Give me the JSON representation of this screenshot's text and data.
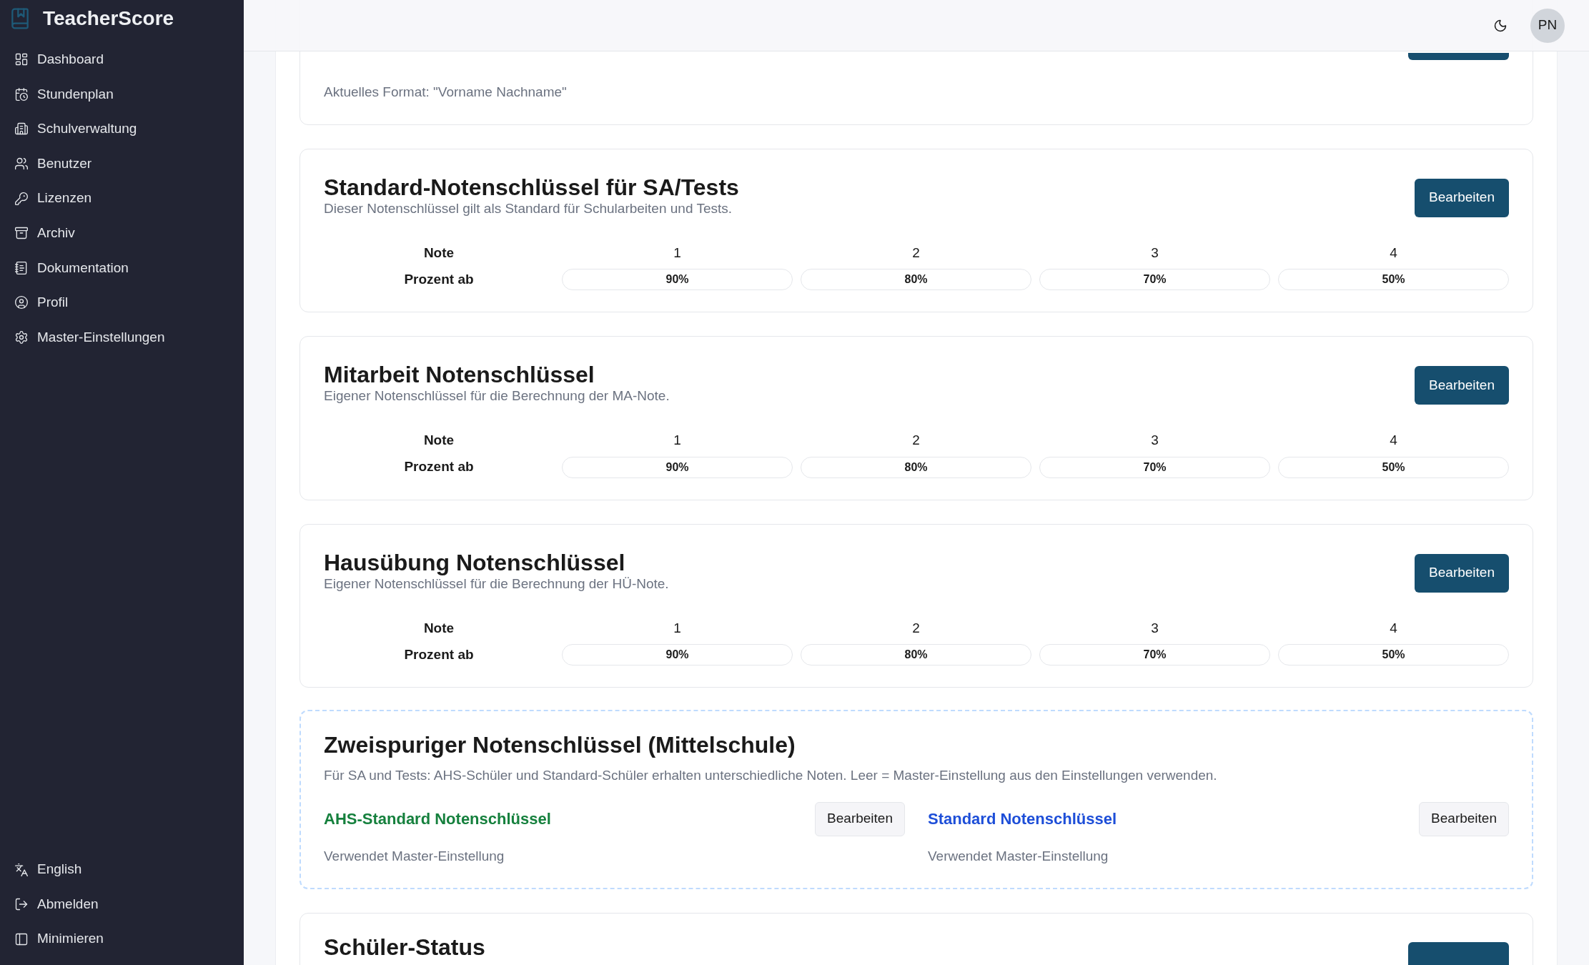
{
  "sidebar": {
    "brand": "TeacherScore",
    "items": [
      {
        "label": "Dashboard"
      },
      {
        "label": "Stundenplan"
      },
      {
        "label": "Schulverwaltung"
      },
      {
        "label": "Benutzer"
      },
      {
        "label": "Lizenzen"
      },
      {
        "label": "Archiv"
      },
      {
        "label": "Dokumentation"
      },
      {
        "label": "Profil"
      },
      {
        "label": "Master-Einstellungen"
      }
    ],
    "bottom_items": [
      {
        "label": "English"
      },
      {
        "label": "Abmelden"
      },
      {
        "label": "Minimieren"
      }
    ]
  },
  "header": {
    "avatar": "PN"
  },
  "name_format_card": {
    "current_format": "Aktuelles Format: \"Vorname Nachname\""
  },
  "grade_keys": [
    {
      "title": "Standard-Notenschlüssel für SA/Tests",
      "subtitle": "Dieser Notenschlüssel gilt als Standard für Schularbeiten und Tests.",
      "button": "Bearbeiten",
      "row_label_grade": "Note",
      "row_label_percent": "Prozent ab",
      "grades": [
        "1",
        "2",
        "3",
        "4"
      ],
      "percents": [
        "90%",
        "80%",
        "70%",
        "50%"
      ]
    },
    {
      "title": "Mitarbeit Notenschlüssel",
      "subtitle": "Eigener Notenschlüssel für die Berechnung der MA-Note.",
      "button": "Bearbeiten",
      "row_label_grade": "Note",
      "row_label_percent": "Prozent ab",
      "grades": [
        "1",
        "2",
        "3",
        "4"
      ],
      "percents": [
        "90%",
        "80%",
        "70%",
        "50%"
      ]
    },
    {
      "title": "Hausübung Notenschlüssel",
      "subtitle": "Eigener Notenschlüssel für die Berechnung der HÜ-Note.",
      "button": "Bearbeiten",
      "row_label_grade": "Note",
      "row_label_percent": "Prozent ab",
      "grades": [
        "1",
        "2",
        "3",
        "4"
      ],
      "percents": [
        "90%",
        "80%",
        "70%",
        "50%"
      ]
    }
  ],
  "dual_key": {
    "title": "Zweispuriger Notenschlüssel (Mittelschule)",
    "description": "Für SA und Tests: AHS-Schüler und Standard-Schüler erhalten unterschiedliche Noten. Leer = Master-Einstellung aus den Einstellungen verwenden.",
    "tracks": [
      {
        "title": "AHS-Standard Notenschlüssel",
        "color": "#15803d",
        "button": "Bearbeiten",
        "status": "Verwendet Master-Einstellung"
      },
      {
        "title": "Standard Notenschlüssel",
        "color": "#1d4ed8",
        "button": "Bearbeiten",
        "status": "Verwendet Master-Einstellung"
      }
    ]
  },
  "student_status_card": {
    "title": "Schüler-Status"
  }
}
